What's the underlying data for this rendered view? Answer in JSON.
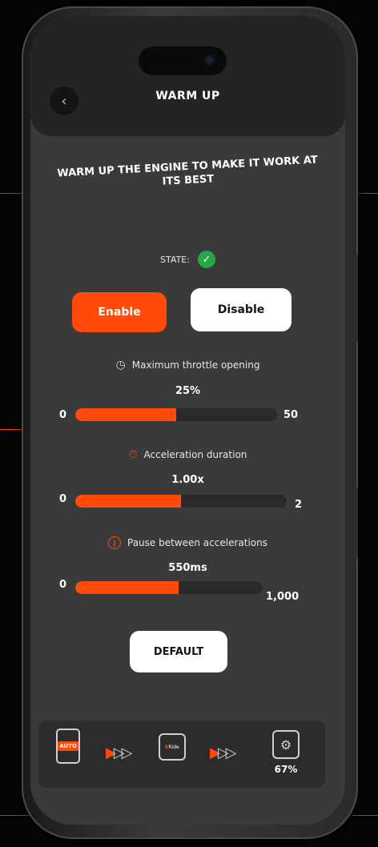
{
  "header": {
    "title": "WARM UP",
    "back_icon": "chevron-left-icon"
  },
  "subtitle": "WARM UP THE ENGINE TO MAKE IT WORK AT ITS BEST",
  "state": {
    "label": "STATE:",
    "icon": "check-circle-icon",
    "status_color": "#27a745"
  },
  "toggle": {
    "enable_label": "Enable",
    "disable_label": "Disable",
    "active": "Enable"
  },
  "params": [
    {
      "label": "Maximum throttle opening",
      "icon": "speedometer-icon",
      "value_text": "25%",
      "min": "0",
      "max": "50",
      "fraction": 0.5
    },
    {
      "label": "Acceleration duration",
      "icon": "stopwatch-icon",
      "value_text": "1.00x",
      "min": "0",
      "max": "2",
      "fraction": 0.5
    },
    {
      "label": "Pause between accelerations",
      "icon": "pause-icon",
      "value_text": "550ms",
      "min": "0",
      "max": "1,000",
      "fraction": 0.55
    }
  ],
  "default_button": "DEFAULT",
  "bottom_nav": {
    "auto_badge": "AUTO",
    "ride_label_prefix": "E",
    "ride_label_suffix": "Ride",
    "battery_percent": "67%"
  },
  "colors": {
    "accent": "#ff4a0a",
    "background": "#3a3a3a",
    "header": "#242424"
  }
}
